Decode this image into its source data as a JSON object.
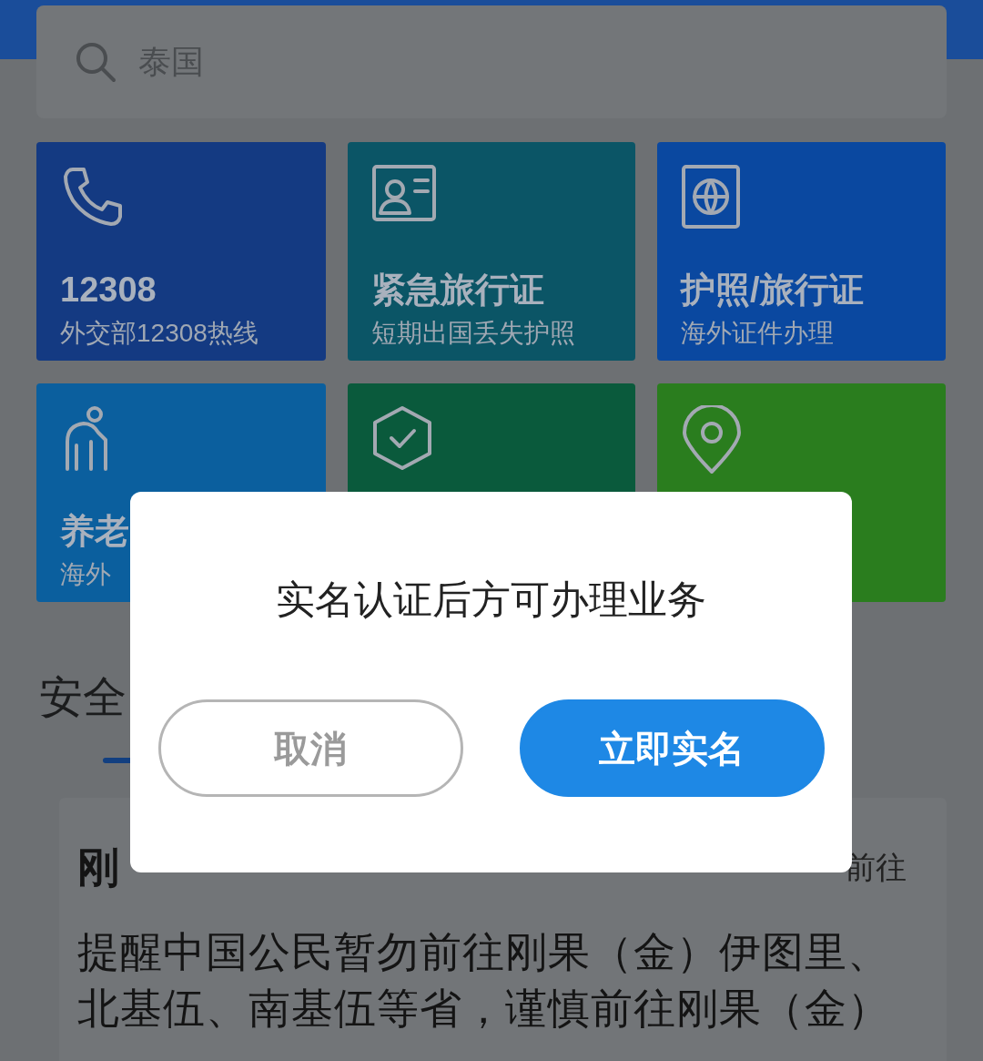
{
  "search": {
    "placeholder": "泰国"
  },
  "tiles": [
    {
      "title": "12308",
      "subtitle": "外交部12308热线",
      "color": "#143a82"
    },
    {
      "title": "紧急旅行证",
      "subtitle": "短期出国丢失护照",
      "color": "#0b5566"
    },
    {
      "title": "护照/旅行证",
      "subtitle": "海外证件办理",
      "color": "#0a48a0"
    },
    {
      "title": "养老",
      "subtitle": "海外",
      "color": "#0b5f9e"
    },
    {
      "color": "#0a5a3c"
    },
    {
      "color": "#2a7d1e"
    }
  ],
  "section": {
    "title": "安全"
  },
  "notice": {
    "title": "刚",
    "tag": "前往",
    "body": "提醒中国公民暂勿前往刚果（金）伊图里、北基伍、南基伍等省，谨慎前往刚果（金）"
  },
  "dialog": {
    "message": "实名认证后方可办理业务",
    "buttons": [
      {
        "label": "取消",
        "kind": "cancel"
      },
      {
        "label": "立即实名",
        "kind": "confirm"
      }
    ]
  }
}
